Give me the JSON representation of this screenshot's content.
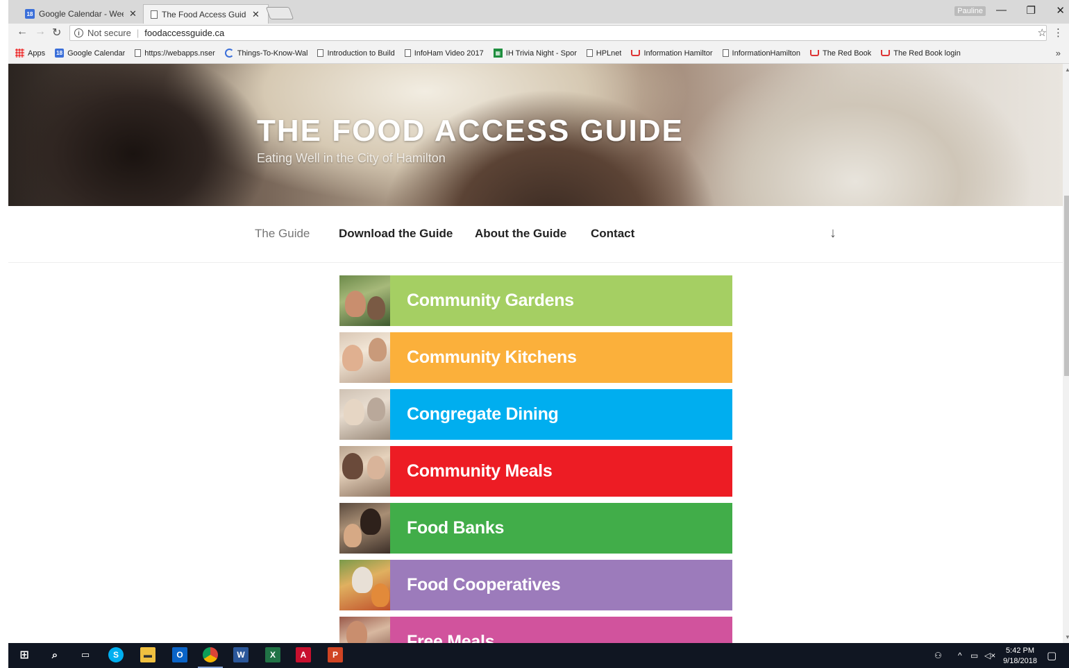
{
  "browser": {
    "tabs": [
      {
        "title": "Google Calendar - Week",
        "icon": "calendar-icon"
      },
      {
        "title": "The Food Access Guide –",
        "icon": "page-icon"
      }
    ],
    "profile": "Pauline",
    "security_label": "Not secure",
    "url": "foodaccessguide.ca",
    "bookmarks": [
      {
        "label": "Apps",
        "icon": "apps-icon"
      },
      {
        "label": "Google Calendar",
        "icon": "calendar-icon"
      },
      {
        "label": "https://webapps.nser",
        "icon": "page-icon"
      },
      {
        "label": "Things-To-Know-Wal",
        "icon": "loading-icon"
      },
      {
        "label": "Introduction to Build",
        "icon": "page-icon"
      },
      {
        "label": "InfoHam Video 2017",
        "icon": "page-icon"
      },
      {
        "label": "IH Trivia Night - Spor",
        "icon": "sheets-icon"
      },
      {
        "label": "HPLnet",
        "icon": "page-icon"
      },
      {
        "label": "Information Hamiltor",
        "icon": "book-icon"
      },
      {
        "label": "InformationHamilton",
        "icon": "page-icon"
      },
      {
        "label": "The Red Book",
        "icon": "book-icon"
      },
      {
        "label": "The Red Book login",
        "icon": "book-icon"
      }
    ],
    "bookmarks_more": "»"
  },
  "site": {
    "title": "THE FOOD ACCESS GUIDE",
    "subtitle": "Eating Well in the City of Hamilton",
    "nav": [
      {
        "label": "The Guide",
        "current": true
      },
      {
        "label": "Download the Guide",
        "current": false
      },
      {
        "label": "About the Guide",
        "current": false
      },
      {
        "label": "Contact",
        "current": false
      }
    ],
    "scroll_arrow": "↓",
    "guide_items": [
      {
        "label": "Community Gardens",
        "color": "#a5cf63"
      },
      {
        "label": "Community Kitchens",
        "color": "#fbb03b"
      },
      {
        "label": "Congregate Dining",
        "color": "#00aeef"
      },
      {
        "label": "Community Meals",
        "color": "#ed1c24"
      },
      {
        "label": "Food Banks",
        "color": "#41ad49"
      },
      {
        "label": "Food Cooperatives",
        "color": "#9c7bbb"
      },
      {
        "label": "Free Meals",
        "color": "#d1539d"
      }
    ]
  },
  "taskbar": {
    "time": "5:42 PM",
    "date": "9/18/2018"
  }
}
